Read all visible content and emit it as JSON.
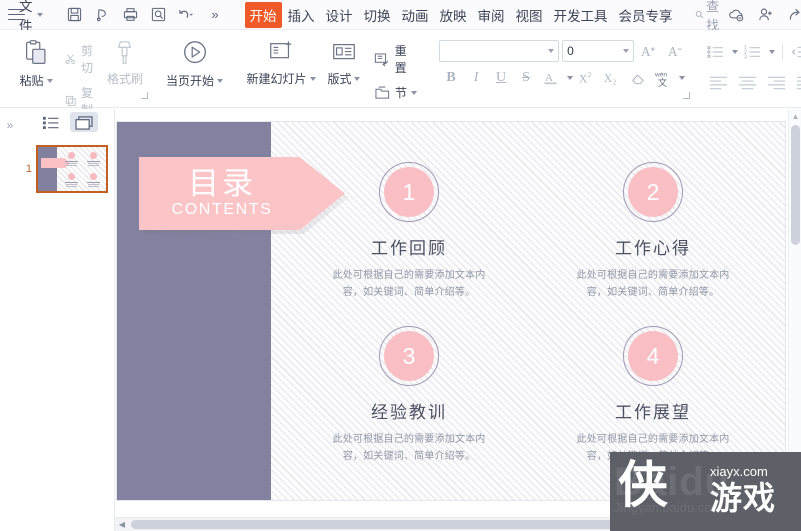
{
  "menubar": {
    "hamburger_icon": "hamburger-icon",
    "file_label": "文件",
    "quick_icons": [
      "save-icon",
      "sync-icon",
      "print-icon",
      "print-preview-icon",
      "undo-icon",
      "more-icon"
    ],
    "tabs": [
      {
        "label": "开始",
        "active": true
      },
      {
        "label": "插入",
        "active": false
      },
      {
        "label": "设计",
        "active": false
      },
      {
        "label": "切换",
        "active": false
      },
      {
        "label": "动画",
        "active": false
      },
      {
        "label": "放映",
        "active": false
      },
      {
        "label": "审阅",
        "active": false
      },
      {
        "label": "视图",
        "active": false
      },
      {
        "label": "开发工具",
        "active": false
      },
      {
        "label": "会员专享",
        "active": false
      }
    ],
    "find_label": "查找",
    "right_icons": [
      "cloud-icon",
      "add-user-icon",
      "share-icon",
      "more-vertical-icon"
    ]
  },
  "ribbon": {
    "clipboard": {
      "paste_label": "粘贴",
      "cut_label": "剪切",
      "copy_label": "复制",
      "format_painter_label": "格式刷"
    },
    "slideshow": {
      "from_current_label": "当页开始"
    },
    "slides": {
      "new_slide_label": "新建幻灯片",
      "layout_label": "版式",
      "reset_label": "重置",
      "section_label": "节"
    },
    "font": {
      "font_name_value": "",
      "font_size_value": "0",
      "grow_font_icon": "grow-font-icon",
      "shrink_font_icon": "shrink-font-icon",
      "bold_icon": "bold-icon",
      "italic_icon": "italic-icon",
      "underline_icon": "underline-icon",
      "strikethrough_icon": "strikethrough-icon",
      "font_color_icon": "font-color-icon",
      "superscript_icon": "superscript-icon",
      "subscript_icon": "subscript-icon",
      "clear_format_icon": "clear-format-icon",
      "pinyin_icon": "pinyin-guide-icon"
    },
    "paragraph": {
      "bullets_icon": "bullet-list-icon",
      "numbering_icon": "numbered-list-icon",
      "decrease_indent_icon": "decrease-indent-icon",
      "increase_indent_icon": "increase-indent-icon",
      "align_left_icon": "align-left-icon",
      "align_center_icon": "align-center-icon",
      "align_right_icon": "align-right-icon",
      "align_justify_icon": "align-justify-icon",
      "line_spacing_icon": "line-spacing-icon"
    }
  },
  "sidebar": {
    "collapse_icon": "collapse-chevrons-icon",
    "outline_view_icon": "outline-view-icon",
    "slide_view_icon": "slide-view-icon",
    "slides": [
      {
        "number": "1",
        "selected": true
      }
    ]
  },
  "slide": {
    "banner": {
      "title_cn": "目录",
      "title_en": "CONTENTS"
    },
    "items": [
      {
        "number": "1",
        "title": "工作回顾",
        "desc": "此处可根据自己的需要添加文本内容，如关键词、简单介绍等。"
      },
      {
        "number": "2",
        "title": "工作心得",
        "desc": "此处可根据自己的需要添加文本内容，如关键词、简单介绍等。"
      },
      {
        "number": "3",
        "title": "经验教训",
        "desc": "此处可根据自己的需要添加文本内容，如关键词、简单介绍等。"
      },
      {
        "number": "4",
        "title": "工作展望",
        "desc": "此处可根据自己的需要添加文本内容，如关键词、简单介绍等。"
      }
    ],
    "colors": {
      "band": "#82819f",
      "banner": "#fbc5c8",
      "circle_fill": "#fabfc4",
      "circle_ring": "#9d9ab8",
      "title_text": "#4b5163",
      "desc_text": "#9197a6"
    }
  },
  "watermark": {
    "brand_cn": "侠",
    "brand_cn2": "游戏",
    "domain": "xiayx.com",
    "bg_text": "Baidu",
    "bg_text2": "Jingyan.baidu.com"
  },
  "scrollbars": {
    "v_up_icon": "scroll-up-icon",
    "v_down_icon": "scroll-down-icon",
    "h_left_icon": "scroll-left-icon",
    "h_right_icon": "scroll-right-icon"
  }
}
